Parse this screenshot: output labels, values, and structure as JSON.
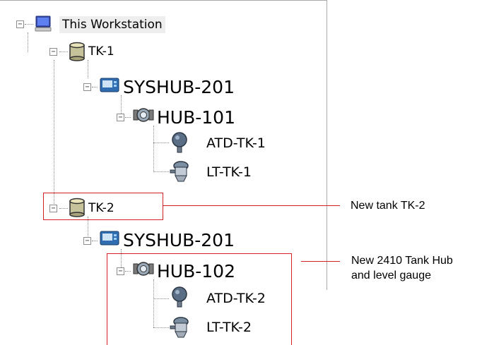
{
  "tree": {
    "root": {
      "label": "This Workstation",
      "icon": "computer-icon"
    },
    "tanks": [
      {
        "label": "TK-1",
        "icon": "tank-icon",
        "syshub": {
          "label": "SYSHUB-201",
          "icon": "system-hub-icon"
        },
        "hub": {
          "label": "HUB-101",
          "icon": "tank-hub-icon"
        },
        "devices": [
          {
            "label": "ATD-TK-1",
            "icon": "temperature-device-icon"
          },
          {
            "label": "LT-TK-1",
            "icon": "level-gauge-icon"
          }
        ]
      },
      {
        "label": "TK-2",
        "icon": "tank-icon",
        "syshub": {
          "label": "SYSHUB-201",
          "icon": "system-hub-icon"
        },
        "hub": {
          "label": "HUB-102",
          "icon": "tank-hub-icon"
        },
        "devices": [
          {
            "label": "ATD-TK-2",
            "icon": "temperature-device-icon"
          },
          {
            "label": "LT-TK-2",
            "icon": "level-gauge-icon"
          }
        ]
      }
    ]
  },
  "callouts": {
    "new_tank": "New tank TK-2",
    "new_hub_line1": "New 2410 Tank Hub",
    "new_hub_line2": "and level gauge"
  },
  "colors": {
    "callout": "#d31f26"
  }
}
